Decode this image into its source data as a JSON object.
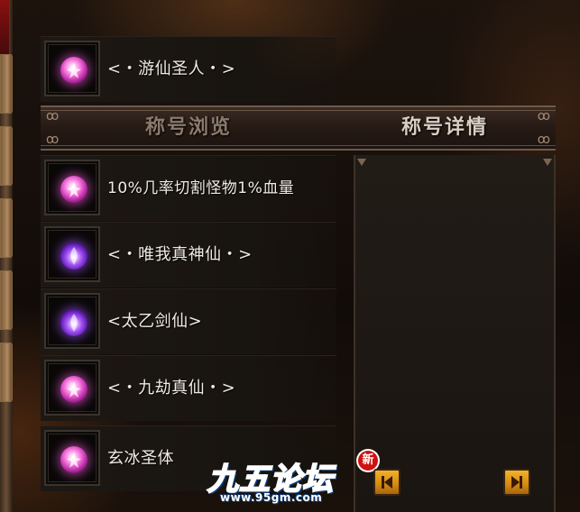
{
  "equipped_title": {
    "icon": "pink-orb-icon",
    "text": "<・游仙圣人・>"
  },
  "header": {
    "tab_browse": "称号浏览",
    "tab_details": "称号详情"
  },
  "titles": [
    {
      "icon": "pink-orb-icon",
      "text": "10%几率切割怪物1%血量"
    },
    {
      "icon": "purple-orb-icon",
      "text": "<・唯我真神仙・>"
    },
    {
      "icon": "purple-orb-icon",
      "text": "<太乙剑仙>"
    },
    {
      "icon": "pink-orb-icon",
      "text": "<・九劫真仙・>"
    },
    {
      "icon": "pink-orb-icon",
      "text": "玄冰圣体"
    }
  ],
  "watermark": {
    "title": "九五论坛",
    "url": "www.95gm.com",
    "badge": "新"
  },
  "colors": {
    "pink_orb": "#f36fd8",
    "purple_orb": "#a65cf2",
    "nav_button": "#f2b12a"
  }
}
